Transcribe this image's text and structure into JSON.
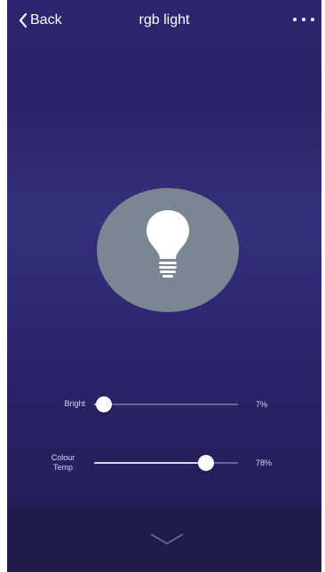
{
  "header": {
    "back_label": "Back",
    "title": "rgb light",
    "back_icon": "chevron-left-icon",
    "more_icon": "more-dots-icon"
  },
  "device": {
    "icon": "lightbulb-icon",
    "circle_color": "#7a8793"
  },
  "sliders": [
    {
      "label": "Bright",
      "value_text": "7%",
      "value": 7
    },
    {
      "label": "Colour\nTemp",
      "value_text": "78%",
      "value": 78
    }
  ],
  "footer": {
    "collapse_icon": "chevron-down-icon"
  },
  "colors": {
    "background_top": "#2c2670",
    "background_bottom": "#221d55",
    "footer": "#1f1b4d",
    "text": "#ffffff"
  }
}
